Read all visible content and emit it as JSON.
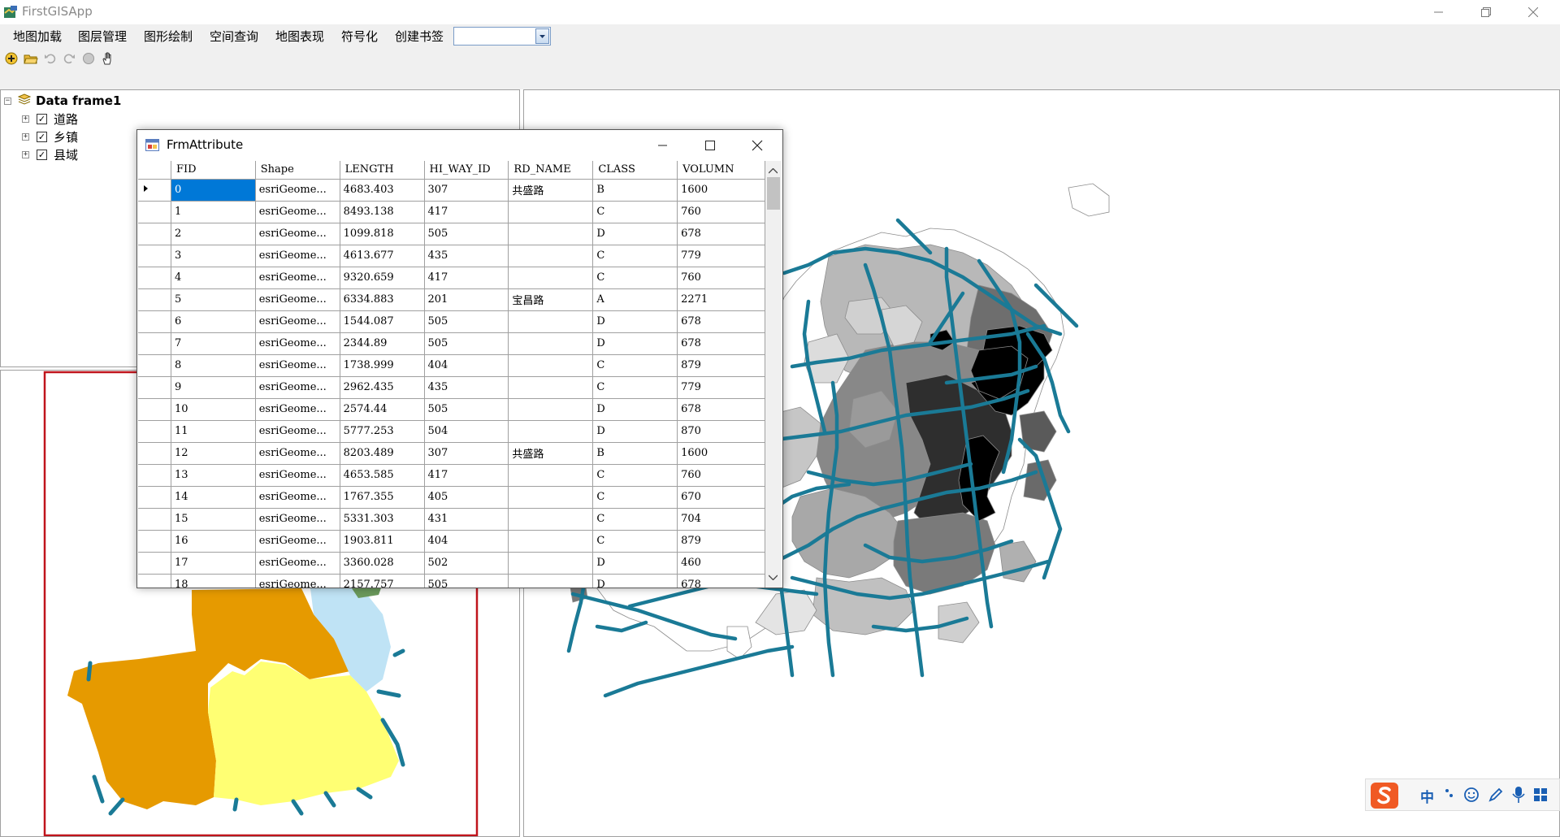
{
  "app": {
    "title": "FirstGISApp"
  },
  "menu": [
    "地图加载",
    "图层管理",
    "图形绘制",
    "空间查询",
    "地图表现",
    "符号化",
    "创建书签"
  ],
  "toolbar_icons": [
    "add-data-icon",
    "open-folder-icon",
    "undo-icon",
    "redo-icon",
    "full-extent-icon",
    "pan-hand-icon"
  ],
  "toc": {
    "frame": "Data frame1",
    "layers": [
      {
        "name": "道路",
        "checked": true
      },
      {
        "name": "乡镇",
        "checked": true
      },
      {
        "name": "县域",
        "checked": true
      }
    ]
  },
  "attr_window": {
    "title": "FrmAttribute",
    "columns": [
      "FID",
      "Shape",
      "LENGTH",
      "HI_WAY_ID",
      "RD_NAME",
      "CLASS",
      "VOLUMN"
    ],
    "rows": [
      [
        "0",
        "esriGeome...",
        "4683.403",
        "307",
        "共盛路",
        "B",
        "1600"
      ],
      [
        "1",
        "esriGeome...",
        "8493.138",
        "417",
        "",
        "C",
        "760"
      ],
      [
        "2",
        "esriGeome...",
        "1099.818",
        "505",
        "",
        "D",
        "678"
      ],
      [
        "3",
        "esriGeome...",
        "4613.677",
        "435",
        "",
        "C",
        "779"
      ],
      [
        "4",
        "esriGeome...",
        "9320.659",
        "417",
        "",
        "C",
        "760"
      ],
      [
        "5",
        "esriGeome...",
        "6334.883",
        "201",
        "宝昌路",
        "A",
        "2271"
      ],
      [
        "6",
        "esriGeome...",
        "1544.087",
        "505",
        "",
        "D",
        "678"
      ],
      [
        "7",
        "esriGeome...",
        "2344.89",
        "505",
        "",
        "D",
        "678"
      ],
      [
        "8",
        "esriGeome...",
        "1738.999",
        "404",
        "",
        "C",
        "879"
      ],
      [
        "9",
        "esriGeome...",
        "2962.435",
        "435",
        "",
        "C",
        "779"
      ],
      [
        "10",
        "esriGeome...",
        "2574.44",
        "505",
        "",
        "D",
        "678"
      ],
      [
        "11",
        "esriGeome...",
        "5777.253",
        "504",
        "",
        "D",
        "870"
      ],
      [
        "12",
        "esriGeome...",
        "8203.489",
        "307",
        "共盛路",
        "B",
        "1600"
      ],
      [
        "13",
        "esriGeome...",
        "4653.585",
        "417",
        "",
        "C",
        "760"
      ],
      [
        "14",
        "esriGeome...",
        "1767.355",
        "405",
        "",
        "C",
        "670"
      ],
      [
        "15",
        "esriGeome...",
        "5331.303",
        "431",
        "",
        "C",
        "704"
      ],
      [
        "16",
        "esriGeome...",
        "1903.811",
        "404",
        "",
        "C",
        "879"
      ],
      [
        "17",
        "esriGeome...",
        "3360.028",
        "502",
        "",
        "D",
        "460"
      ],
      [
        "18",
        "esriGeome...",
        "2157.757",
        "505",
        "",
        "D",
        "678"
      ]
    ]
  },
  "colors": {
    "road": "#1a7a96",
    "overview_border": "#c0141c",
    "overview_orange": "#e69a00",
    "overview_yellow": "#ffff73",
    "overview_lightblue": "#bfe3f5",
    "overview_green": "#6b9a5c",
    "selection": "#0078d7"
  },
  "ime": {
    "lang": "中"
  }
}
